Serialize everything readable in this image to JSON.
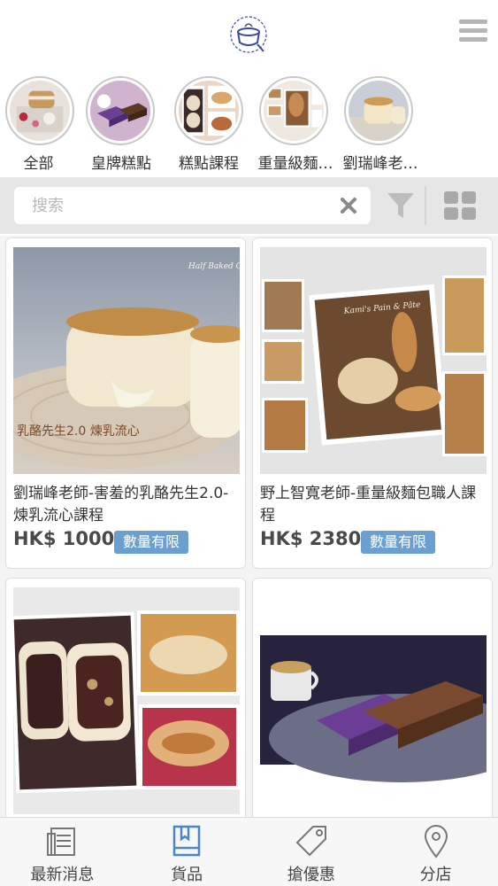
{
  "header": {
    "logo": "cake-pot-logo",
    "menu_icon": "hamburger-menu-icon"
  },
  "categories": [
    {
      "label": "全部",
      "icon": "cake-photo"
    },
    {
      "label": "皇牌糕點",
      "icon": "taro-cake-photo"
    },
    {
      "label": "糕點課程",
      "icon": "pastry-photo"
    },
    {
      "label": "重量級麵…",
      "icon": "bread-photo"
    },
    {
      "label": "劉瑞峰老…",
      "icon": "cheese-cake-photo"
    }
  ],
  "search": {
    "placeholder": "搜索",
    "value": ""
  },
  "products": [
    {
      "title": "劉瑞峰老師-害羞的乳酪先生2.0-煉乳流心課程",
      "price": "HK$ 1000",
      "badge": "數量有限",
      "image_caption": "乳酪先生2.0 煉乳流心",
      "image_watermark": "Half Baked Che"
    },
    {
      "title": "野上智寬老師-重量級麵包職人課程",
      "price": "HK$ 2380",
      "badge": "數量有限",
      "image_caption": "Kami's Pain & Pâte"
    },
    {
      "title": "",
      "price": "",
      "badge": ""
    },
    {
      "title": "",
      "price": "",
      "badge": ""
    }
  ],
  "bottom_nav": [
    {
      "label": "最新消息",
      "icon": "news-icon",
      "active": false
    },
    {
      "label": "貨品",
      "icon": "book-icon",
      "active": true
    },
    {
      "label": "搶優惠",
      "icon": "tag-icon",
      "active": false
    },
    {
      "label": "分店",
      "icon": "location-pin-icon",
      "active": false
    }
  ],
  "colors": {
    "accent": "#4a86c8",
    "badge": "#6a9fd0",
    "search_bg": "#e6e6e6"
  }
}
